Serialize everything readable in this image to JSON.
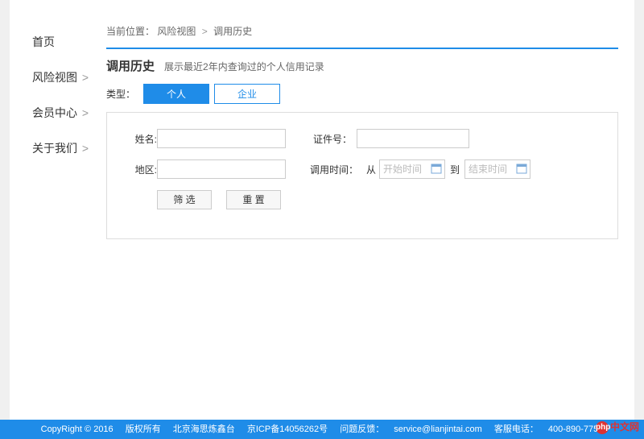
{
  "sidebar": {
    "items": [
      {
        "label": "首页",
        "chevron": false
      },
      {
        "label": "风险视图",
        "chevron": true
      },
      {
        "label": "会员中心",
        "chevron": true
      },
      {
        "label": "关于我们",
        "chevron": true
      }
    ]
  },
  "breadcrumb": {
    "prefix": "当前位置：",
    "parts": [
      "风险视图",
      "调用历史"
    ],
    "sep": ">"
  },
  "header": {
    "title": "调用历史",
    "subtitle": "展示最近2年内查询过的个人信用记录"
  },
  "tabs": {
    "label": "类型：",
    "items": [
      {
        "label": "个人",
        "active": true
      },
      {
        "label": "企业",
        "active": false
      }
    ]
  },
  "form": {
    "name_label": "姓名:",
    "idno_label": "证件号：",
    "region_label": "地区:",
    "time_label": "调用时间：",
    "from_text": "从",
    "to_text": "到",
    "start_placeholder": "开始时间",
    "end_placeholder": "结束时间",
    "filter_btn": "筛 选",
    "reset_btn": "重 置"
  },
  "footer": {
    "copyright": "CopyRight © 2016",
    "rights": "版权所有",
    "company": "北京海思炼鑫台",
    "icp": "京ICP备14056262号",
    "feedback_label": "问题反馈：",
    "feedback_email": "service@lianjintai.com",
    "phone_label": "客服电话：",
    "phone": "400-890-7756"
  },
  "watermark": {
    "text": "中文网",
    "badge": "php"
  }
}
